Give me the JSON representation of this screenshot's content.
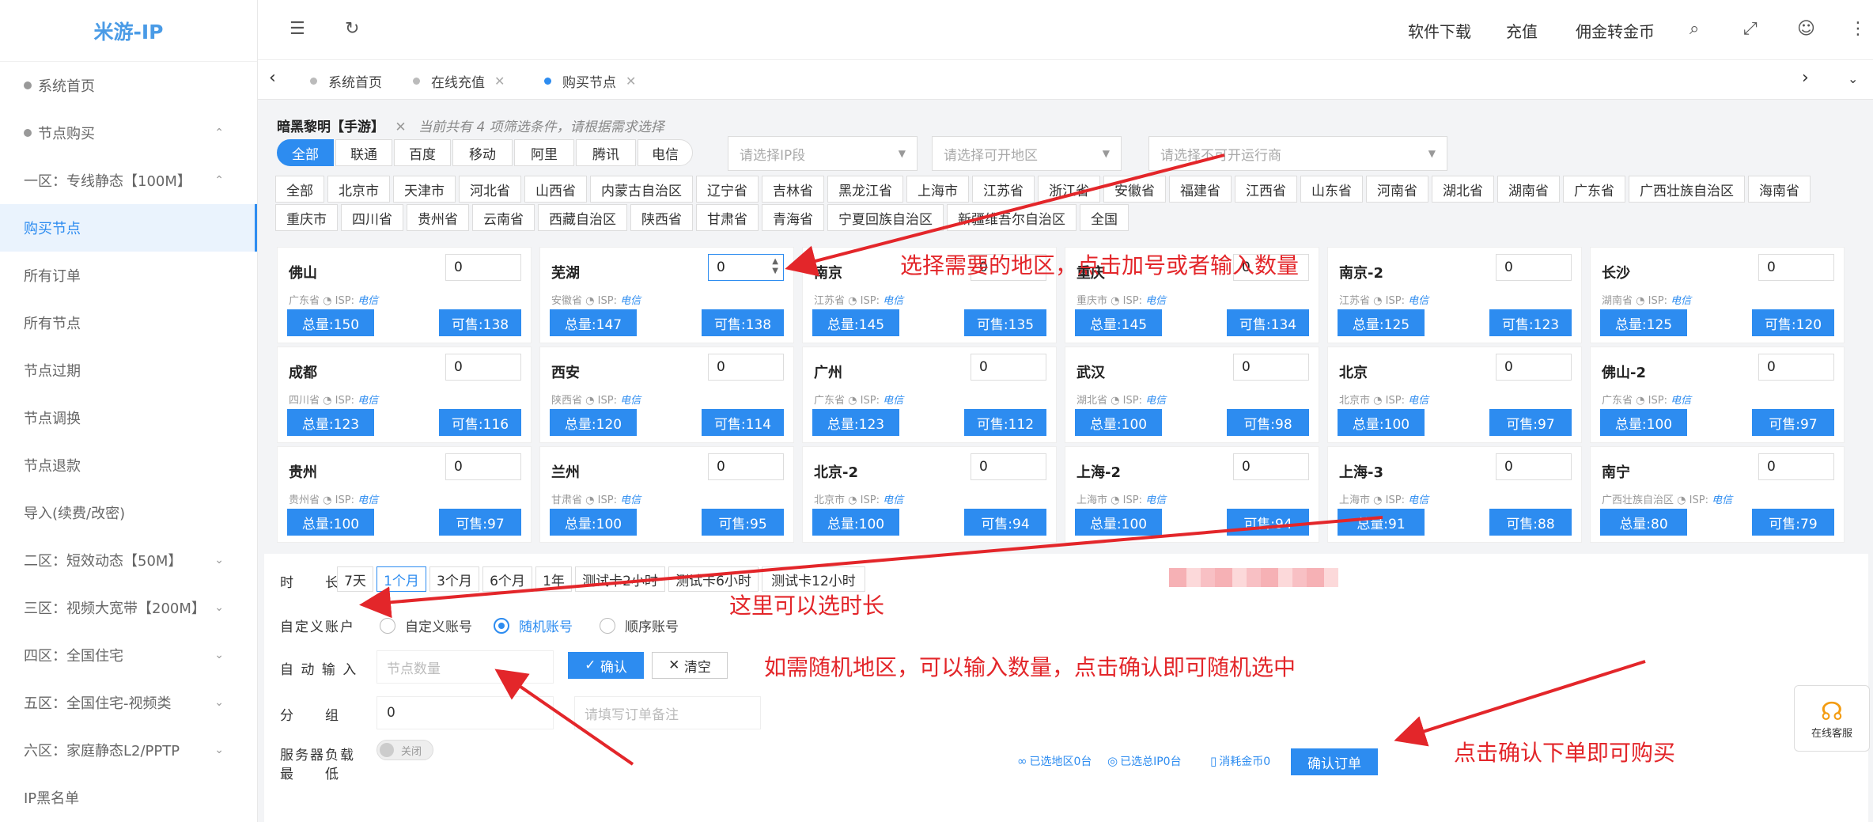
{
  "app": {
    "title": "米游-IP"
  },
  "sidebar": {
    "items": [
      {
        "label": "系统首页",
        "dot": true
      },
      {
        "label": "节点购买",
        "dot": true,
        "chev": "⌃"
      },
      {
        "label": "一区：专线静态【100M】",
        "chev": "⌃"
      },
      {
        "label": "购买节点",
        "active": true
      },
      {
        "label": "所有订单"
      },
      {
        "label": "所有节点"
      },
      {
        "label": "节点过期"
      },
      {
        "label": "节点调换"
      },
      {
        "label": "节点退款"
      },
      {
        "label": "导入(续费/改密)"
      },
      {
        "label": "二区：短效动态【50M】",
        "chev": "⌄"
      },
      {
        "label": "三区：视频大宽带【200M】",
        "chev": "⌄"
      },
      {
        "label": "四区：全国住宅",
        "chev": "⌄"
      },
      {
        "label": "五区：全国住宅-视频类",
        "chev": "⌄"
      },
      {
        "label": "六区：家庭静态L2/PPTP",
        "chev": "⌄"
      },
      {
        "label": "IP黑名单"
      }
    ]
  },
  "header": {
    "links": [
      "软件下载",
      "充值",
      "佣金转金币"
    ]
  },
  "tabs": [
    {
      "label": "系统首页",
      "closable": false,
      "active": false
    },
    {
      "label": "在线充值",
      "closable": true,
      "active": false
    },
    {
      "label": "购买节点",
      "closable": true,
      "active": true
    }
  ],
  "filter": {
    "game": "暗黑黎明【手游】",
    "hint": "当前共有 4 项筛选条件，请根据需求选择",
    "isps": [
      "全部",
      "联通",
      "百度",
      "移动",
      "阿里",
      "腾讯",
      "电信"
    ],
    "selects": [
      "请选择IP段",
      "请选择可开地区",
      "请选择不可开运行商"
    ],
    "regions": [
      "全部",
      "北京市",
      "天津市",
      "河北省",
      "山西省",
      "内蒙古自治区",
      "辽宁省",
      "吉林省",
      "黑龙江省",
      "上海市",
      "江苏省",
      "浙江省",
      "安徽省",
      "福建省",
      "江西省",
      "山东省",
      "河南省",
      "湖北省",
      "湖南省",
      "广东省",
      "广西壮族自治区",
      "海南省",
      "重庆市",
      "四川省",
      "贵州省",
      "云南省",
      "西藏自治区",
      "陕西省",
      "甘肃省",
      "青海省",
      "宁夏回族自治区",
      "新疆维吾尔自治区",
      "全国"
    ]
  },
  "isp_label": "ISP:",
  "nodes": [
    {
      "name": "佛山",
      "qty": "0",
      "prov": "广东省",
      "isp": "电信",
      "total": "总量:150",
      "avail": "可售:138"
    },
    {
      "name": "芜湖",
      "qty": "0",
      "prov": "安徽省",
      "isp": "电信",
      "total": "总量:147",
      "avail": "可售:138"
    },
    {
      "name": "南京",
      "qty": "0",
      "prov": "江苏省",
      "isp": "电信",
      "total": "总量:145",
      "avail": "可售:135"
    },
    {
      "name": "重庆",
      "qty": "0",
      "prov": "重庆市",
      "isp": "电信",
      "total": "总量:145",
      "avail": "可售:134"
    },
    {
      "name": "南京-2",
      "qty": "0",
      "prov": "江苏省",
      "isp": "电信",
      "total": "总量:125",
      "avail": "可售:123"
    },
    {
      "name": "长沙",
      "qty": "0",
      "prov": "湖南省",
      "isp": "电信",
      "total": "总量:125",
      "avail": "可售:120"
    },
    {
      "name": "成都",
      "qty": "0",
      "prov": "四川省",
      "isp": "电信",
      "total": "总量:123",
      "avail": "可售:116"
    },
    {
      "name": "西安",
      "qty": "0",
      "prov": "陕西省",
      "isp": "电信",
      "total": "总量:120",
      "avail": "可售:114"
    },
    {
      "name": "广州",
      "qty": "0",
      "prov": "广东省",
      "isp": "电信",
      "total": "总量:123",
      "avail": "可售:112"
    },
    {
      "name": "武汉",
      "qty": "0",
      "prov": "湖北省",
      "isp": "电信",
      "total": "总量:100",
      "avail": "可售:98"
    },
    {
      "name": "北京",
      "qty": "0",
      "prov": "北京市",
      "isp": "电信",
      "total": "总量:100",
      "avail": "可售:97"
    },
    {
      "name": "佛山-2",
      "qty": "0",
      "prov": "广东省",
      "isp": "电信",
      "total": "总量:100",
      "avail": "可售:97"
    },
    {
      "name": "贵州",
      "qty": "0",
      "prov": "贵州省",
      "isp": "电信",
      "total": "总量:100",
      "avail": "可售:97"
    },
    {
      "name": "兰州",
      "qty": "0",
      "prov": "甘肃省",
      "isp": "电信",
      "total": "总量:100",
      "avail": "可售:95"
    },
    {
      "name": "北京-2",
      "qty": "0",
      "prov": "北京市",
      "isp": "电信",
      "total": "总量:100",
      "avail": "可售:94"
    },
    {
      "name": "上海-2",
      "qty": "0",
      "prov": "上海市",
      "isp": "电信",
      "total": "总量:100",
      "avail": "可售:94"
    },
    {
      "name": "上海-3",
      "qty": "0",
      "prov": "上海市",
      "isp": "电信",
      "total": "总量:91",
      "avail": "可售:88"
    },
    {
      "name": "南宁",
      "qty": "0",
      "prov": "广西壮族自治区",
      "isp": "电信",
      "total": "总量:80",
      "avail": "可售:79"
    }
  ],
  "order": {
    "duration_label": "时　　长",
    "durations": [
      "7天",
      "1个月",
      "3个月",
      "6个月",
      "1年",
      "测试卡2小时",
      "测试卡6小时",
      "测试卡12小时"
    ],
    "account_label": "自定义账户",
    "account_options": [
      "自定义账号",
      "随机账号",
      "顺序账号"
    ],
    "auto_label": "自 动 输 入",
    "auto_placeholder": "节点数量",
    "confirm_label": "确认",
    "clear_label": "清空",
    "group_label": "分　　组",
    "group_value": "0",
    "remark_placeholder": "请填写订单备注",
    "lb_label_1": "服务器负载",
    "lb_label_2": "最　　低",
    "toggle_label": "关闭",
    "stat_region": "已选地区0台",
    "stat_ip": "已选总IP0台",
    "stat_coin": "消耗金币0",
    "submit_label": "确认订单"
  },
  "service": {
    "label": "在线客服"
  },
  "annotations": {
    "a1": "选择需要的地区，点击加号或者输入数量",
    "a2": "这里可以选时长",
    "a3": "如需随机地区，可以输入数量，点击确认即可随机选中",
    "a4": "点击确认下单即可购买"
  },
  "colors": {
    "accent": "#2d8cf0",
    "annotation": "#e3262a"
  }
}
